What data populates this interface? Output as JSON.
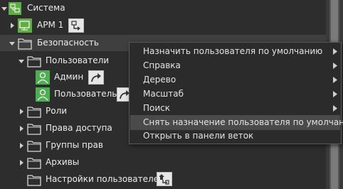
{
  "tree": {
    "root": {
      "label": "Система",
      "expanded": true
    },
    "arm": {
      "label": "АРМ 1",
      "expanded": false
    },
    "security": {
      "label": "Безопасность",
      "expanded": true
    },
    "users": {
      "label": "Пользователи",
      "expanded": true
    },
    "admin": {
      "label": "Админ"
    },
    "user": {
      "label": "Пользователь"
    },
    "roles": {
      "label": "Роли",
      "expanded": false
    },
    "access_rights": {
      "label": "Права доступа",
      "expanded": false
    },
    "rights_groups": {
      "label": "Группы прав",
      "expanded": false
    },
    "archives": {
      "label": "Архивы",
      "expanded": false
    },
    "user_settings": {
      "label": "Настройки пользователей"
    }
  },
  "context_menu": {
    "items": [
      {
        "label": "Назначить пользователя по умолчанию",
        "has_submenu": true
      },
      {
        "label": "Справка",
        "has_submenu": true
      },
      {
        "label": "Дерево",
        "has_submenu": true
      },
      {
        "label": "Масштаб",
        "has_submenu": true
      },
      {
        "label": "Поиск",
        "has_submenu": true
      },
      {
        "label": "Снять назначение пользователя по умолчанию",
        "has_submenu": false,
        "highlighted": true
      },
      {
        "label": "Открыть в панели веток",
        "has_submenu": false
      }
    ]
  },
  "colors": {
    "background": "#2d2d2d",
    "selected_row": "#3f3f3f",
    "menu_background": "#2b2b2b",
    "menu_highlight": "#4a4a4a",
    "user_icon_green": "#4caf50",
    "folder_outline": "#d8d8d8"
  },
  "icons": {
    "expand": "triangle-down-icon",
    "collapse": "triangle-right-icon",
    "folder": "folder-icon",
    "network": "network-icon",
    "computer": "computer-icon",
    "user": "user-icon",
    "link_arrow": "arrow-link-icon",
    "submenu": "chevron-right-icon"
  }
}
